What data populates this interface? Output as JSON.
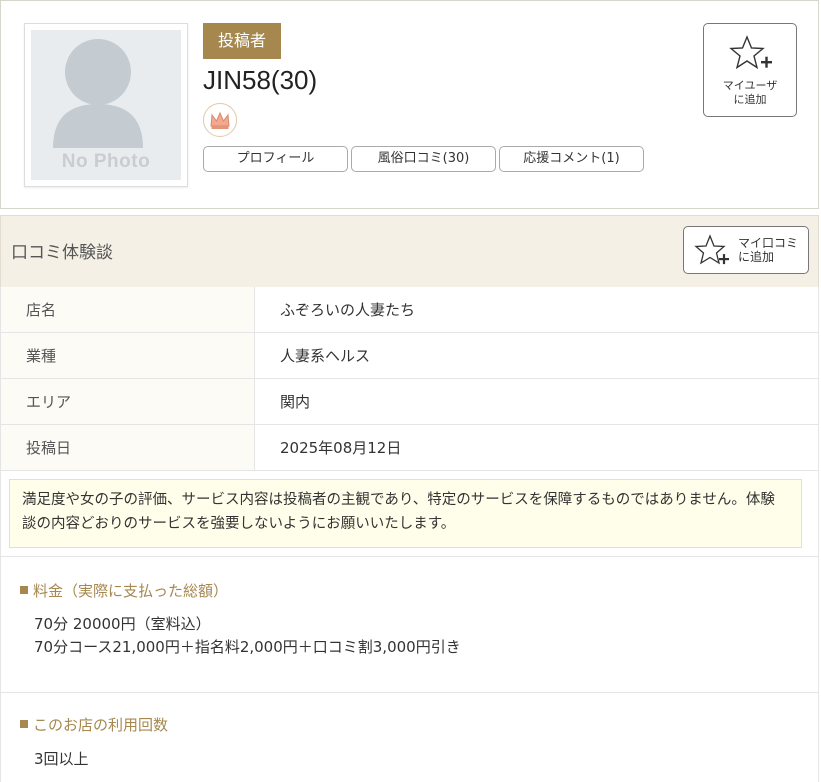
{
  "profile": {
    "badge": "投稿者",
    "username": "JIN58(30)",
    "avatar_placeholder": "No Photo",
    "rank_icon": "crown-icon",
    "tabs": [
      {
        "label": "プロフィール"
      },
      {
        "label": "風俗口コミ(30)"
      },
      {
        "label": "応援コメント(1)"
      }
    ],
    "myuser_button": {
      "line1": "マイユーザ",
      "line2": "に追加",
      "icon": "star-plus-icon"
    }
  },
  "review": {
    "section_title": "口コミ体験談",
    "add_button": {
      "line1": "マイ口コミ",
      "line2": "に追加",
      "icon": "star-plus-icon"
    },
    "info": [
      {
        "label": "店名",
        "value": "ふぞろいの人妻たち"
      },
      {
        "label": "業種",
        "value": "人妻系ヘルス"
      },
      {
        "label": "エリア",
        "value": "関内"
      },
      {
        "label": "投稿日",
        "value": "2025年08月12日"
      }
    ],
    "notice": "満足度や女の子の評価、サービス内容は投稿者の主観であり、特定のサービスを保障するものではありません。体験談の内容どおりのサービスを強要しないようにお願いいたします。",
    "price": {
      "title": "料金（実際に支払った総額）",
      "line1": "70分 20000円（室料込）",
      "line2": "70分コース21,000円＋指名料2,000円＋口コミ割3,000円引き"
    },
    "visits": {
      "title": "このお店の利用回数",
      "value": "3回以上"
    }
  },
  "colors": {
    "accent": "#a6884f",
    "header_bg": "#f4f0e6",
    "notice_bg": "#fffeea",
    "label_bg": "#fcfbf5"
  }
}
